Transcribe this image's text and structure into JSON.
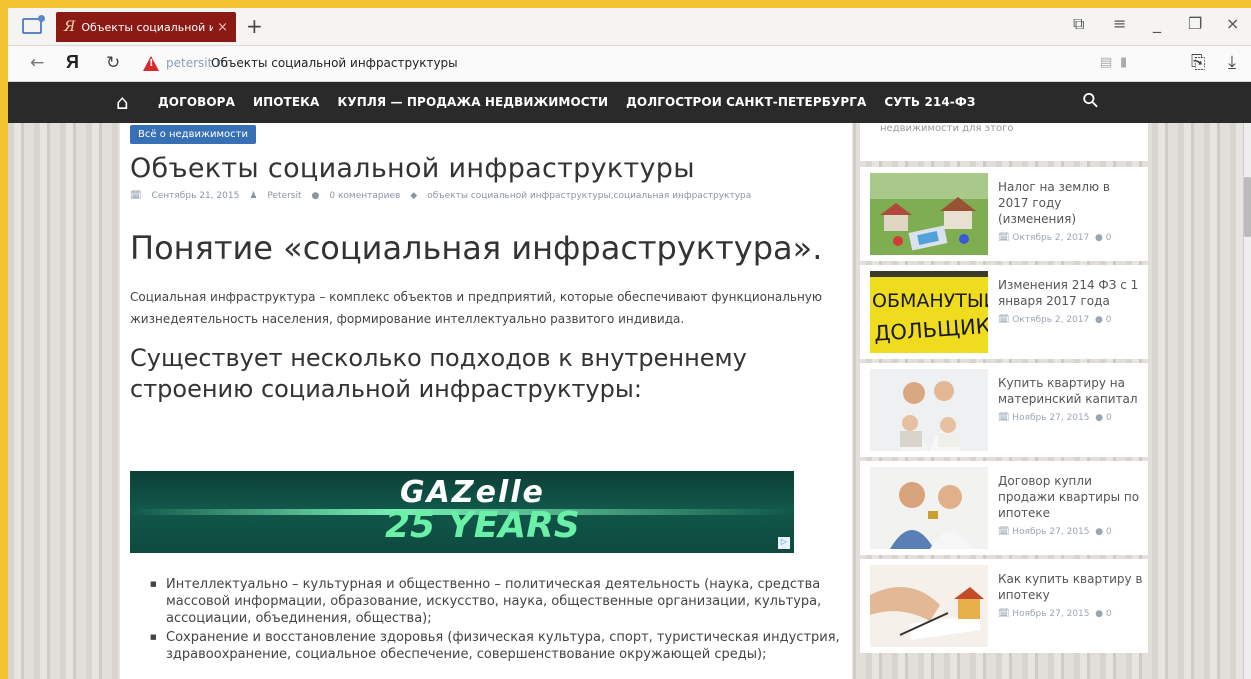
{
  "browser": {
    "tab_icon": "Я",
    "tab_title": "Объекты социальной и",
    "tab_close": "×",
    "new_tab": "+",
    "yandex_logo": "Я",
    "warn_mark": "!",
    "domain": "petersit.ru",
    "page_title": "Объекты социальной инфраструктуры"
  },
  "site_nav": {
    "items": [
      "ДОГОВОРА",
      "ИПОТЕКА",
      "КУПЛЯ — ПРОДАЖА НЕДВИЖИМОСТИ",
      "ДОЛГОСТРОИ САНКТ-ПЕТЕРБУРГА",
      "СУТЬ 214-ФЗ"
    ]
  },
  "article": {
    "category": "Всё о недвижимости",
    "title": "Объекты социальной инфраструктуры",
    "date": "Сентябрь 21, 2015",
    "author": "Petersit",
    "comments": "0 коментариев",
    "tags": "объекты социальной инфраструктуры,социальная инфраструктура",
    "heading1": "Понятие «социальная инфраструктура».",
    "paragraph": "Социальная инфраструктура – комплекс объектов и предприятий, которые обеспечивают функциональную жизнедеятельность населения, формирование интеллектуально развитого индивида.",
    "heading2": "Существует несколько подходов к внутреннему строению социальной инфраструктуры:",
    "bullets": [
      "Интеллектуально – культурная и общественно – политическая деятельность (наука, средства массовой информации, образование, искусство, наука, общественные организации, культура, ассоциации, объединения, общества);",
      "Сохранение и восстановление здоровья (физическая культура, спорт, туристическая индустрия, здравоохранение, социальное обеспечение, совершенствование окружающей среды);"
    ]
  },
  "ad": {
    "brand": "GAZelle",
    "slogan": "25 YEARS"
  },
  "sidebar": {
    "top_fragment": "недвижимости для этого",
    "posts": [
      {
        "title": "Налог на землю в 2017 году (изменения)",
        "date": "Октябрь 2, 2017",
        "comments": "0"
      },
      {
        "title": "Изменения 214 ФЗ с 1 января 2017 года",
        "date": "Октябрь 2, 2017",
        "comments": "0",
        "image_text": "ОБМАНУТЫЙ ДОЛЬЩИК"
      },
      {
        "title": "Купить квартиру на материнский капитал",
        "date": "Ноябрь 27, 2015",
        "comments": "0"
      },
      {
        "title": "Договор купли продажи квартиры по ипотеке",
        "date": "Ноябрь 27, 2015",
        "comments": "0"
      },
      {
        "title": "Как купить квартиру в ипотеку",
        "date": "Ноябрь 27, 2015",
        "comments": "0"
      }
    ]
  }
}
